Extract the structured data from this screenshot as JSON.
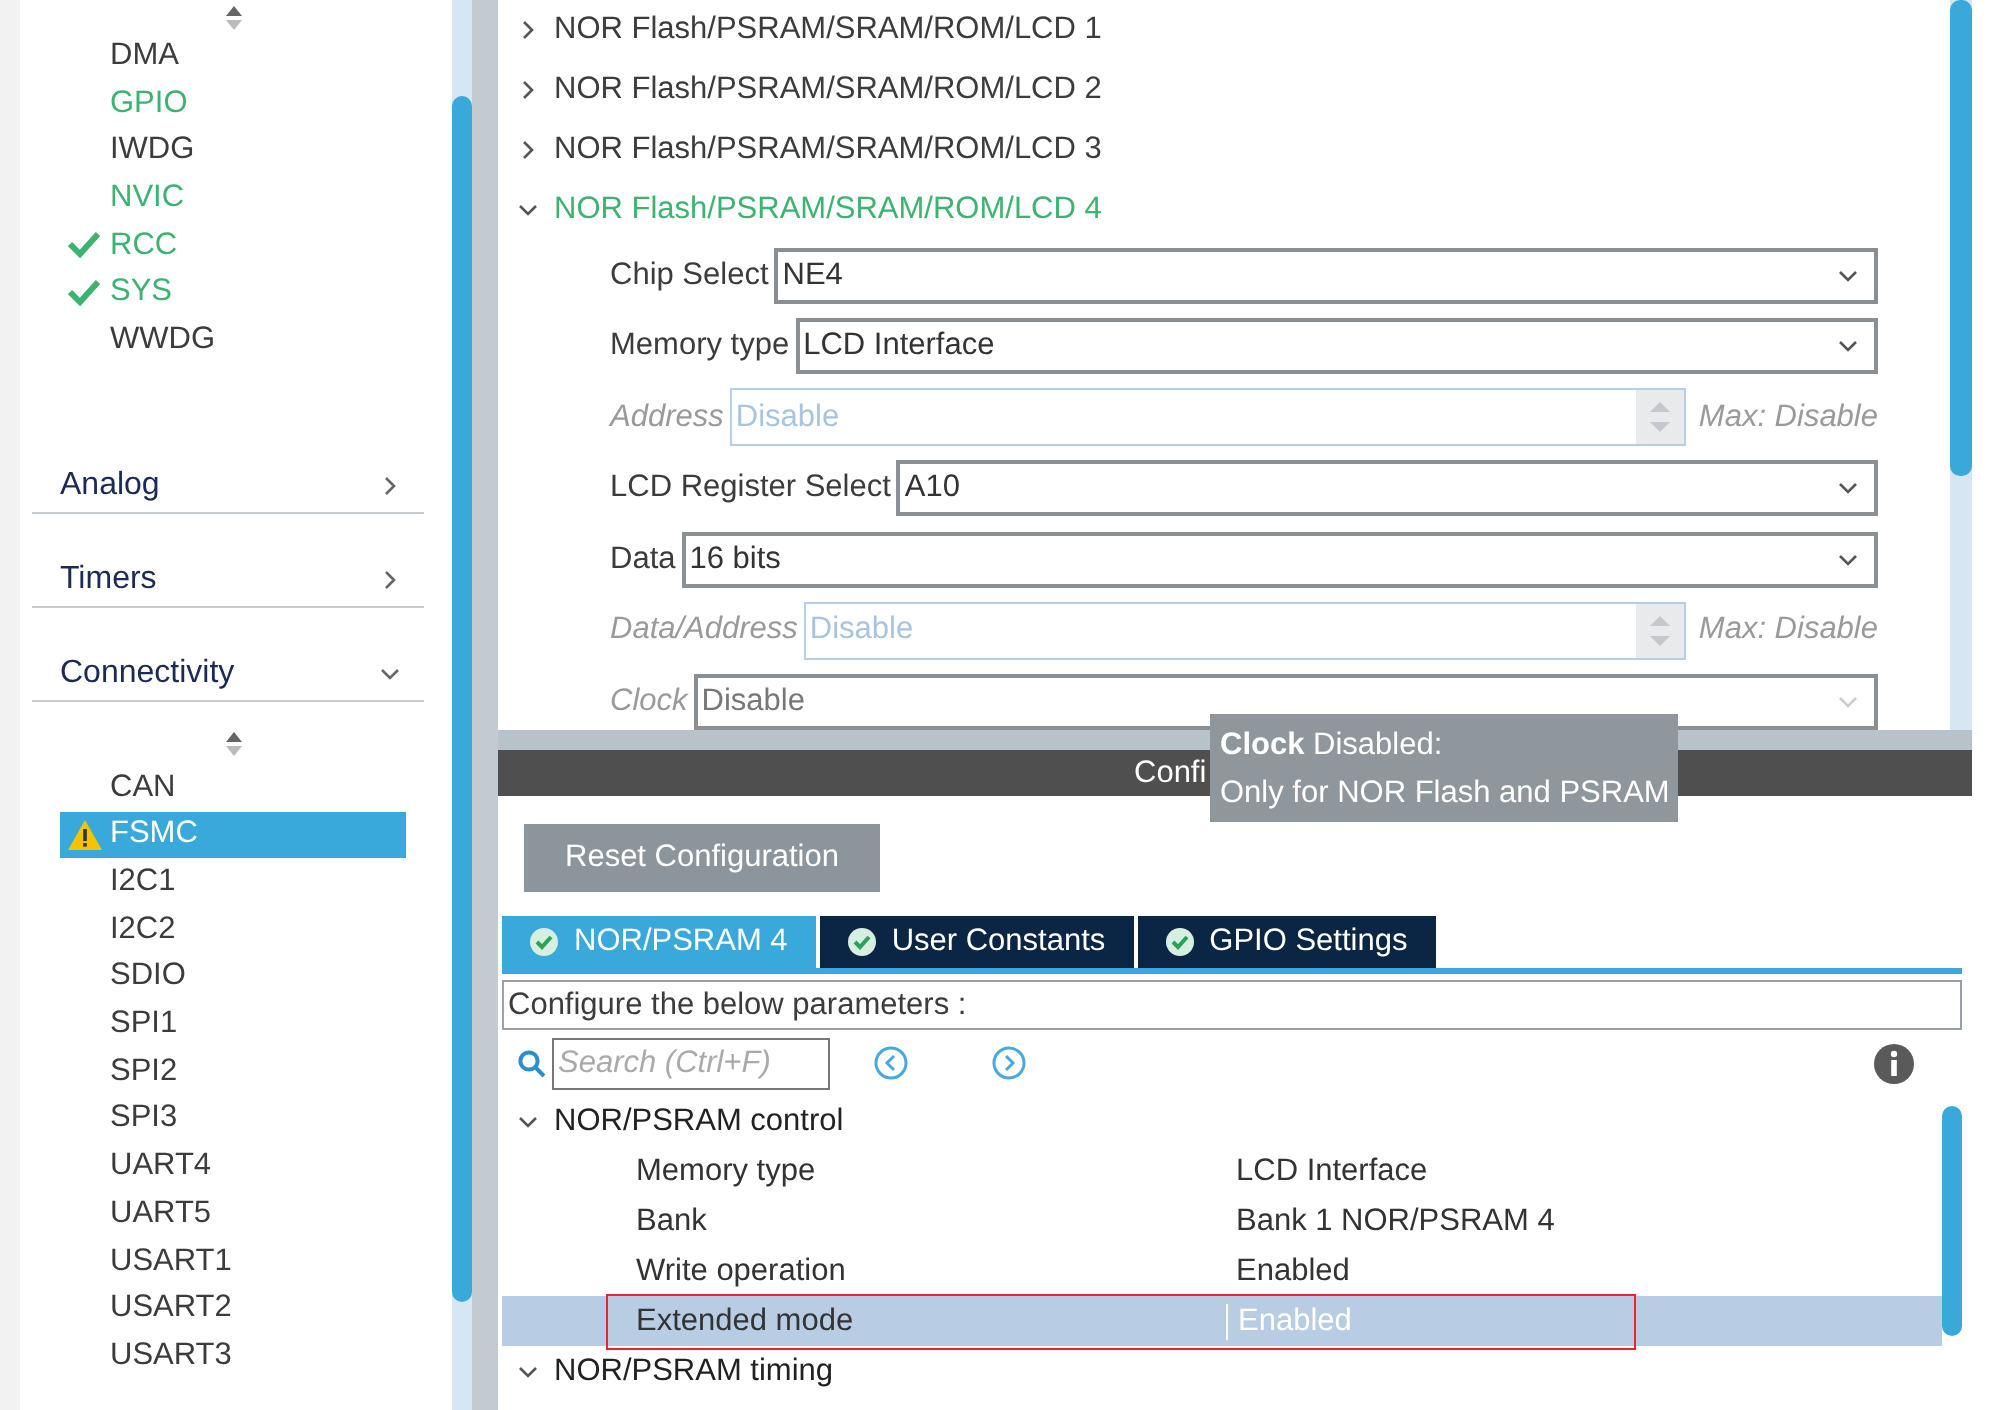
{
  "sidebar": {
    "top_items": [
      {
        "label": "DMA",
        "configured": false,
        "checked": false
      },
      {
        "label": "GPIO",
        "configured": true,
        "checked": false
      },
      {
        "label": "IWDG",
        "configured": false,
        "checked": false
      },
      {
        "label": "NVIC",
        "configured": true,
        "checked": false
      },
      {
        "label": "RCC",
        "configured": true,
        "checked": true
      },
      {
        "label": "SYS",
        "configured": true,
        "checked": true
      },
      {
        "label": "WWDG",
        "configured": false,
        "checked": false
      }
    ],
    "sections": [
      {
        "label": "Analog",
        "expanded": false
      },
      {
        "label": "Timers",
        "expanded": false
      },
      {
        "label": "Connectivity",
        "expanded": true
      }
    ],
    "items": [
      {
        "label": "CAN",
        "warning": false,
        "selected": false
      },
      {
        "label": "FSMC",
        "warning": true,
        "selected": true
      },
      {
        "label": "I2C1",
        "warning": false,
        "selected": false
      },
      {
        "label": "I2C2",
        "warning": false,
        "selected": false
      },
      {
        "label": "SDIO",
        "warning": false,
        "selected": false
      },
      {
        "label": "SPI1",
        "warning": false,
        "selected": false
      },
      {
        "label": "SPI2",
        "warning": false,
        "selected": false
      },
      {
        "label": "SPI3",
        "warning": false,
        "selected": false
      },
      {
        "label": "UART4",
        "warning": false,
        "selected": false
      },
      {
        "label": "UART5",
        "warning": false,
        "selected": false
      },
      {
        "label": "USART1",
        "warning": false,
        "selected": false
      },
      {
        "label": "USART2",
        "warning": false,
        "selected": false
      },
      {
        "label": "USART3",
        "warning": false,
        "selected": false
      }
    ]
  },
  "mode": {
    "groups": [
      {
        "label": "NOR Flash/PSRAM/SRAM/ROM/LCD 1",
        "expanded": false
      },
      {
        "label": "NOR Flash/PSRAM/SRAM/ROM/LCD 2",
        "expanded": false
      },
      {
        "label": "NOR Flash/PSRAM/SRAM/ROM/LCD 3",
        "expanded": false
      },
      {
        "label": "NOR Flash/PSRAM/SRAM/ROM/LCD 4",
        "expanded": true
      }
    ],
    "fields": [
      {
        "kind": "select",
        "label": "Chip Select",
        "value": "NE4",
        "disabled": false
      },
      {
        "kind": "select",
        "label": "Memory type",
        "value": "LCD Interface",
        "disabled": false
      },
      {
        "kind": "spinner",
        "label": "Address",
        "value": "Disable",
        "disabled": true,
        "max": "Max: Disable"
      },
      {
        "kind": "select",
        "label": "LCD Register Select",
        "value": "A10",
        "disabled": false
      },
      {
        "kind": "select",
        "label": "Data",
        "value": "16 bits",
        "disabled": false
      },
      {
        "kind": "spinner",
        "label": "Data/Address",
        "value": "Disable",
        "disabled": true,
        "max": "Max: Disable"
      },
      {
        "kind": "select",
        "label": "Clock",
        "value": "Disable",
        "disabled": true
      }
    ]
  },
  "tooltip": {
    "lines": [
      "**Clock** Disabled:",
      "Only for NOR Flash and PSRAM"
    ]
  },
  "configuration": {
    "header": "Confi",
    "reset_button": "Reset Configuration",
    "tabs": [
      {
        "label": "NOR/PSRAM 4",
        "selected": true
      },
      {
        "label": "User Constants",
        "selected": false
      },
      {
        "label": "GPIO Settings",
        "selected": false
      }
    ],
    "hint": "Configure the below parameters :",
    "search": {
      "placeholder": "Search (Ctrl+F)"
    },
    "tree": [
      {
        "label": "NOR/PSRAM control",
        "expanded": true,
        "children": [
          {
            "name": "Memory type",
            "value": "LCD Interface",
            "selected": false,
            "highlighted": false
          },
          {
            "name": "Bank",
            "value": "Bank 1 NOR/PSRAM 4",
            "selected": false,
            "highlighted": false
          },
          {
            "name": "Write operation",
            "value": "Enabled",
            "selected": false,
            "highlighted": false
          },
          {
            "name": "Extended mode",
            "value": "Enabled",
            "selected": true,
            "highlighted": true
          }
        ]
      },
      {
        "label": "NOR/PSRAM timing",
        "expanded": true
      }
    ]
  }
}
